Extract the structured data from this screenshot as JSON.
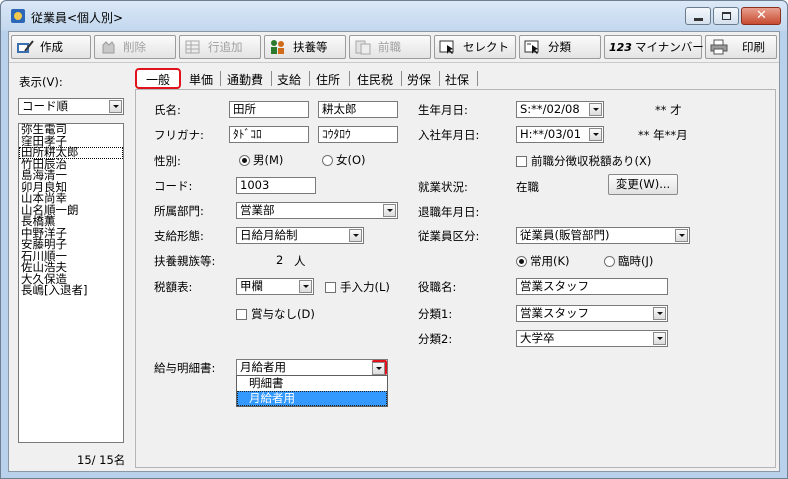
{
  "window": {
    "title": "従業員<個人別>",
    "controls": {
      "minimize": "minimize",
      "maximize": "maximize",
      "close": "✕"
    }
  },
  "toolbar": {
    "buttons": [
      {
        "label": "作成",
        "icon": "pencil-notebook-icon",
        "enabled": true
      },
      {
        "label": "削除",
        "icon": "delete-hand-icon",
        "enabled": false
      },
      {
        "label": "行追加",
        "icon": "add-row-grid-icon",
        "enabled": false
      },
      {
        "label": "扶養等",
        "icon": "family-people-icon",
        "enabled": true
      },
      {
        "label": "前職",
        "icon": "previous-job-icon",
        "enabled": false
      },
      {
        "label": "セレクト",
        "icon": "select-cursor-icon",
        "enabled": true
      },
      {
        "label": "分類",
        "icon": "classification-icon",
        "enabled": true
      },
      {
        "label": "マイナンバー",
        "icon": "my-number-123-icon",
        "prefix": "123",
        "enabled": true
      },
      {
        "label": "印刷",
        "icon": "printer-icon",
        "enabled": true
      }
    ]
  },
  "sidebar": {
    "display_label": "表示(V):",
    "sort_select": "コード順",
    "employees": [
      "弥生電司",
      "窪田孝子",
      "田所耕太郎",
      "竹田辰治",
      "島海清一",
      "卯月良知",
      "山本尚幸",
      "山名順一朗",
      "長橋薫",
      "中野洋子",
      "安藤明子",
      "石川順一",
      "佐山浩夫",
      "大久保造",
      "長嶋[入退者]"
    ],
    "selected_employee": "田所耕太郎",
    "count": "15/  15名"
  },
  "tabs": [
    "一般",
    "単価",
    "通勤費",
    "支給",
    "住所",
    "住民税",
    "労保",
    "社保"
  ],
  "active_tab": "一般",
  "form": {
    "name_label": "氏名:",
    "last_name": "田所",
    "first_name": "耕太郎",
    "furigana_label": "フリガナ:",
    "furigana_last": "ﾀﾄﾞｺﾛ",
    "furigana_first": "ｺｳﾀﾛｳ",
    "gender_label": "性別:",
    "gender_male": "男(M)",
    "gender_female": "女(O)",
    "code_label": "コード:",
    "code": "1003",
    "department_label": "所属部門:",
    "department": "営業部",
    "pay_type_label": "支給形態:",
    "pay_type": "日給月給制",
    "dependents_label": "扶養親族等:",
    "dependents_count": "2",
    "dependents_unit": "人",
    "tax_table_label": "税額表:",
    "tax_table": "甲欄",
    "manual_entry": "手入力(L)",
    "no_bonus": "賞与なし(D)",
    "payslip_label": "給与明細書:",
    "payslip": "月給者用",
    "payslip_options": [
      "明細書",
      "月給者用"
    ],
    "birth_label": "生年月日:",
    "birth_date": "S:**/02/08",
    "age": "** 才",
    "hire_label": "入社年月日:",
    "hire_date": "H:**/03/01",
    "tenure": "** 年**月",
    "prev_job_tax": "前職分徴収税額あり(X)",
    "employment_label": "就業状況:",
    "employment_status": "在職",
    "change_button": "変更(W)...",
    "retire_label": "退職年月日:",
    "employee_class_label": "従業員区分:",
    "employee_class": "従業員(販管部門)",
    "regular": "常用(K)",
    "temporary": "臨時(J)",
    "position_label": "役職名:",
    "position": "営業スタッフ",
    "class1_label": "分類1:",
    "class1": "営業スタッフ",
    "class2_label": "分類2:",
    "class2": "大学卒"
  }
}
